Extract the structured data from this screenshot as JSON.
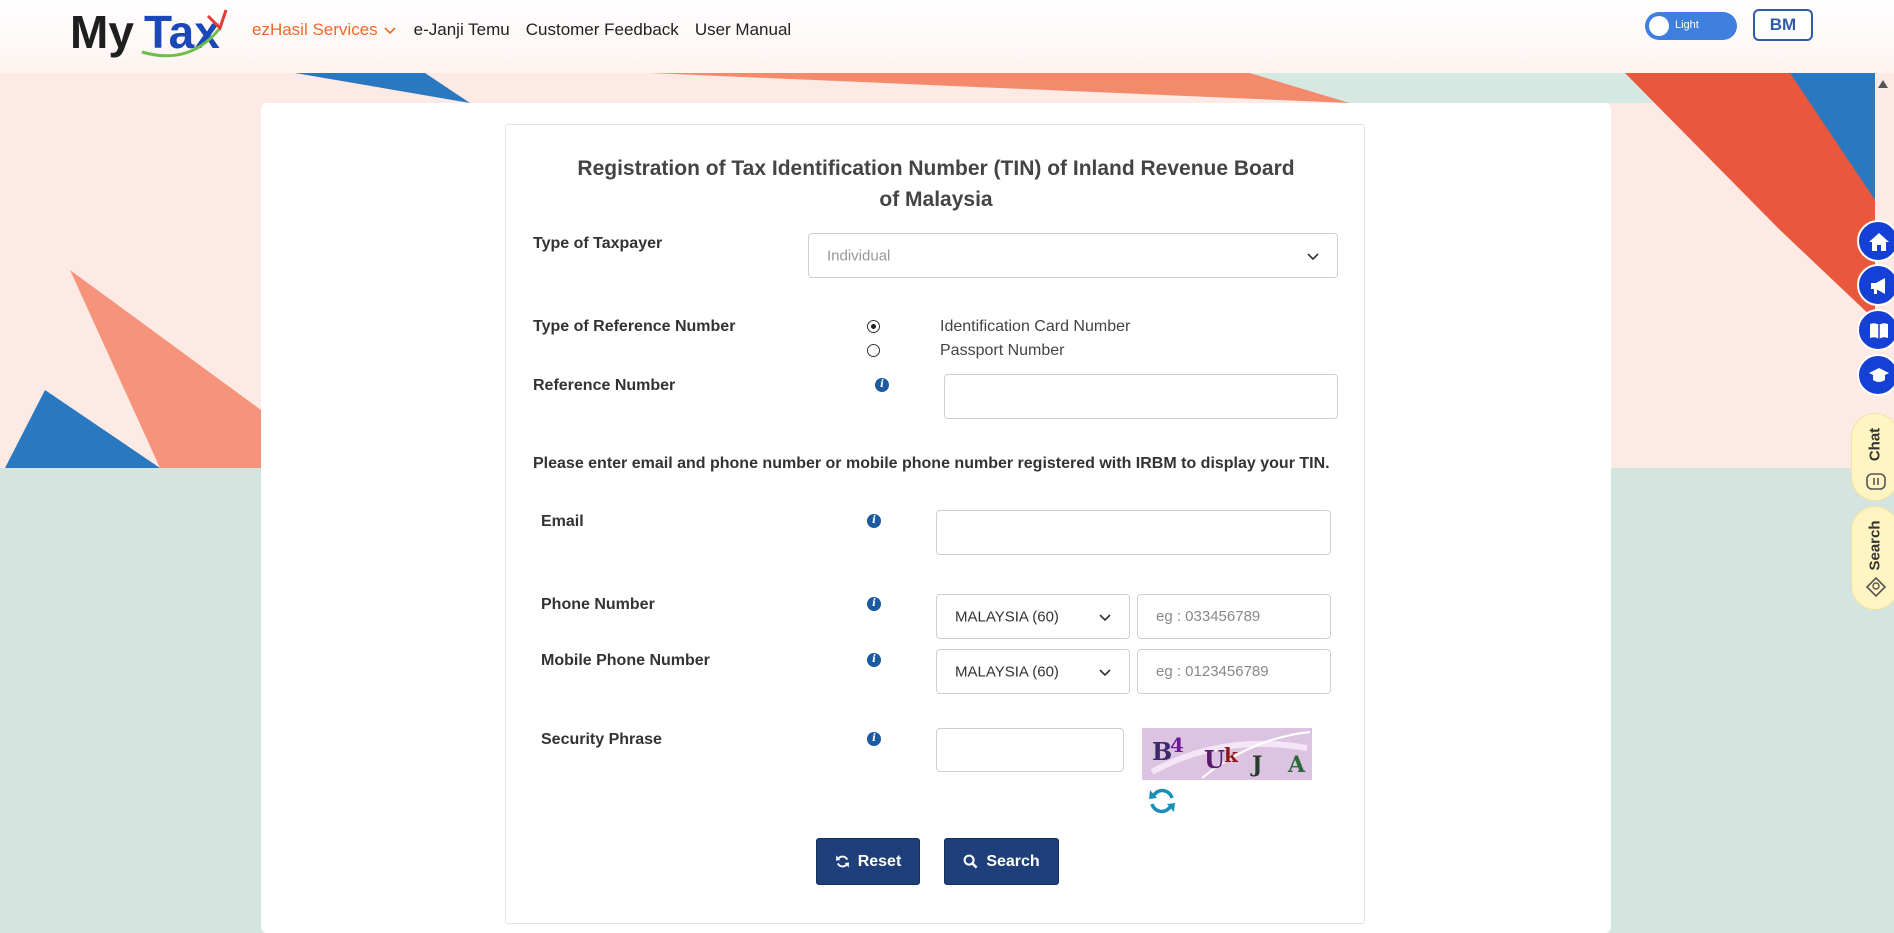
{
  "header": {
    "logo_text": "MyTax",
    "nav": [
      {
        "label": "ezHasil Services"
      },
      {
        "label": "e-Janji Temu"
      },
      {
        "label": "Customer Feedback"
      },
      {
        "label": "User Manual"
      }
    ],
    "theme_toggle_label": "Light",
    "language_button": "BM"
  },
  "form": {
    "title": "Registration of Tax Identification Number (TIN) of Inland Revenue Board of Malaysia",
    "taxpayer_type": {
      "label": "Type of Taxpayer",
      "value": "Individual"
    },
    "reference_type": {
      "label": "Type of Reference Number",
      "options": [
        {
          "label": "Identification Card Number",
          "checked": true
        },
        {
          "label": "Passport Number",
          "checked": false
        }
      ]
    },
    "reference_number": {
      "label": "Reference Number",
      "value": ""
    },
    "note": "Please enter email and phone number or mobile phone number registered with IRBM to display your TIN.",
    "email": {
      "label": "Email",
      "value": ""
    },
    "phone": {
      "label": "Phone Number",
      "country": "MALAYSIA (60)",
      "placeholder": "eg : 033456789"
    },
    "mobile": {
      "label": "Mobile Phone Number",
      "country": "MALAYSIA (60)",
      "placeholder": "eg : 0123456789"
    },
    "security": {
      "label": "Security Phrase",
      "value": "",
      "captcha_text": "B4 U k J A"
    },
    "buttons": {
      "reset": "Reset",
      "search": "Search"
    }
  },
  "side_rail": {
    "icons": [
      "home-icon",
      "megaphone-icon",
      "book-icon",
      "graduation-cap-icon"
    ],
    "chat_label": "Chat",
    "search_label": "Search"
  },
  "colors": {
    "brand_blue": "#1e3f7a",
    "accent_orange": "#ef6a2a",
    "rail_blue": "#1440d6"
  }
}
